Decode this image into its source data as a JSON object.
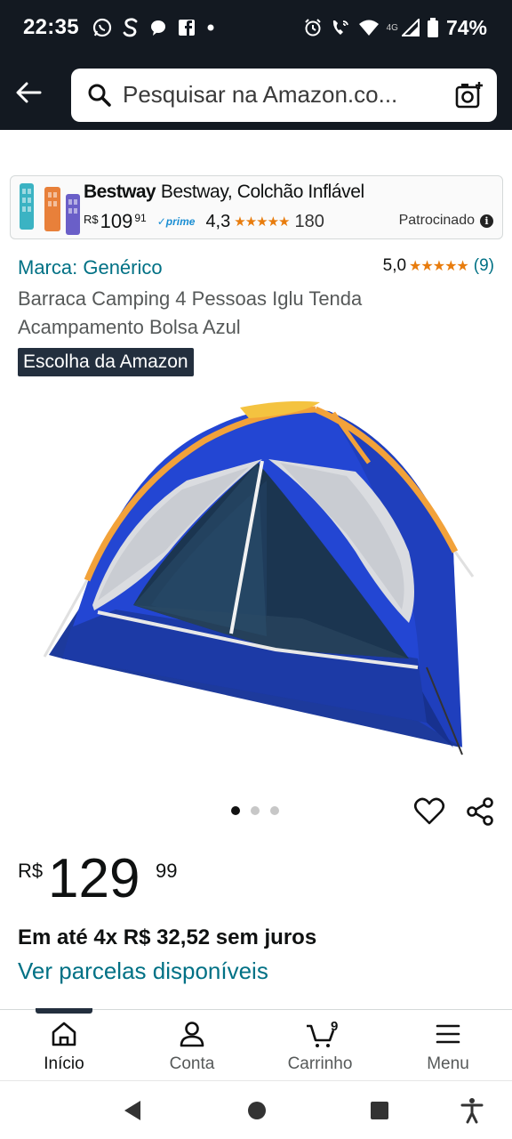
{
  "status_bar": {
    "time": "22:35",
    "battery_percent": "74%",
    "network_label": "4G",
    "left_icons": [
      "whatsapp-icon",
      "s-app-icon",
      "chat-bubble-icon",
      "facebook-icon",
      "more-dot-icon"
    ],
    "right_icons": [
      "alarm-icon",
      "call-wifi-icon",
      "wifi-icon",
      "signal-icon",
      "battery-icon"
    ]
  },
  "header": {
    "search_placeholder": "Pesquisar na Amazon.co...",
    "back_icon": "back-arrow-icon",
    "camera_icon": "camera-scan-icon",
    "background": "#131921"
  },
  "sponsored_ad": {
    "brand": "Bestway",
    "product_name": "Bestway, Colchão Inflável",
    "price_symbol": "R$",
    "price_whole": "109",
    "price_cents": "91",
    "prime_label": "✓prime",
    "rating": "4,3",
    "stars": "★★★★★",
    "review_count": "180",
    "sponsored_label": "Patrocinado",
    "info_icon": "i"
  },
  "product": {
    "brand_link": "Marca: Genérico",
    "rating": "5,0",
    "stars": "★★★★★",
    "review_count": "(9)",
    "title": "Barraca Camping 4 Pessoas Iglu Tenda Acampamento Bolsa Azul",
    "badge": "Escolha da Amazon",
    "image_icon": "tent-product-image",
    "carousel_position": 1,
    "carousel_total": 3
  },
  "price": {
    "symbol": "R$",
    "whole": "129",
    "cents": "99",
    "installments": "Em até 4x R$ 32,52 sem juros",
    "installments_link": "Ver parcelas disponíveis"
  },
  "bottom_nav": {
    "items": [
      {
        "label": "Início",
        "icon": "home-icon",
        "active": true
      },
      {
        "label": "Conta",
        "icon": "user-icon",
        "active": false
      },
      {
        "label": "Carrinho",
        "icon": "cart-icon",
        "active": false
      },
      {
        "label": "Menu",
        "icon": "menu-icon",
        "active": false
      }
    ],
    "cart_count": "9"
  },
  "colors": {
    "header_bg": "#131921",
    "link": "#007185",
    "star": "#e87c0d",
    "badge_bg": "#232f3e",
    "tent_blue": "#1f3fbf",
    "tent_orange": "#f2a23a"
  }
}
